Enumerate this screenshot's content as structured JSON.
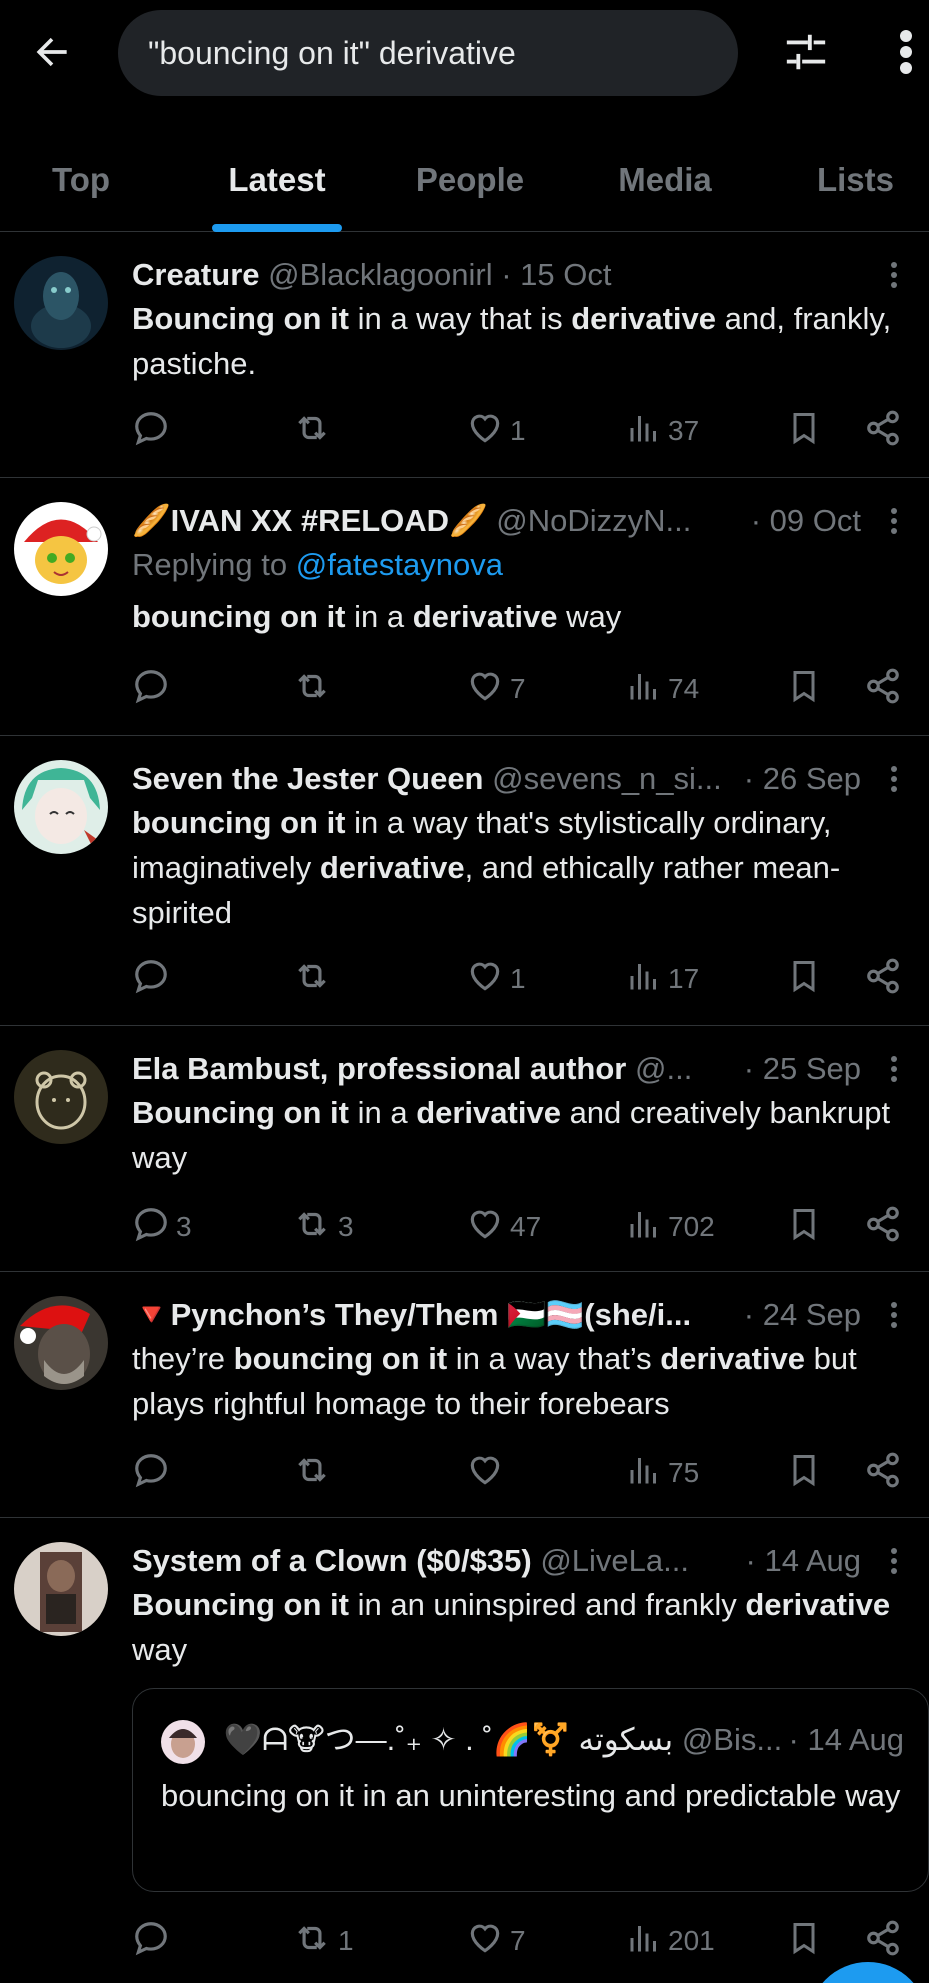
{
  "search": {
    "query": "\"bouncing on it\" derivative"
  },
  "tabs": [
    {
      "label": "Top"
    },
    {
      "label": "Latest"
    },
    {
      "label": "People"
    },
    {
      "label": "Media"
    },
    {
      "label": "Lists"
    }
  ],
  "colors": {
    "accent": "#1d9bf0",
    "muted": "#71767b",
    "text": "#e7e9ea",
    "background": "#000000"
  },
  "posts": [
    {
      "name": "Creature",
      "handle": "@Blacklagoonirl",
      "time": "15 Oct",
      "text_parts": [
        {
          "b": "Bouncing on it"
        },
        {
          "t": " in a way that is "
        },
        {
          "b": "derivative"
        },
        {
          "t": " and, frankly, pastiche."
        }
      ],
      "replies": "",
      "reposts": "",
      "likes": "1",
      "views": "37"
    },
    {
      "name": "🥖IVAN XX #RELOAD🥖",
      "handle": "@NoDizzyN...",
      "time": "09 Oct",
      "reply_to_prefix": "Replying to",
      "reply_to": "@fatestaynova",
      "text_parts": [
        {
          "b": "bouncing on it"
        },
        {
          "t": " in a "
        },
        {
          "b": "derivative"
        },
        {
          "t": " way"
        }
      ],
      "replies": "",
      "reposts": "",
      "likes": "7",
      "views": "74"
    },
    {
      "name": "Seven the Jester Queen",
      "handle": "@sevens_n_si...",
      "time": "26 Sep",
      "text_parts": [
        {
          "b": "bouncing on it"
        },
        {
          "t": " in a way that's stylistically ordinary, imaginatively "
        },
        {
          "b": "derivative"
        },
        {
          "t": ", and ethically rather mean-spirited"
        }
      ],
      "replies": "",
      "reposts": "",
      "likes": "1",
      "views": "17"
    },
    {
      "name": "Ela Bambust, professional author",
      "handle": "@...",
      "time": "25 Sep",
      "text_parts": [
        {
          "b": "Bouncing on it"
        },
        {
          "t": " in a "
        },
        {
          "b": "derivative"
        },
        {
          "t": " and creatively bankrupt way"
        }
      ],
      "replies": "3",
      "reposts": "3",
      "likes": "47",
      "views": "702"
    },
    {
      "name": "🔻Pynchon’s They/Them 🇵🇸🏳️‍⚧️(she/i...",
      "handle": "",
      "time": "24 Sep",
      "text_parts": [
        {
          "t": "they’re "
        },
        {
          "b": "bouncing on it"
        },
        {
          "t": " in a way that’s "
        },
        {
          "b": "derivative"
        },
        {
          "t": " but plays rightful homage to their forebears"
        }
      ],
      "replies": "",
      "reposts": "",
      "likes": "",
      "views": "75"
    },
    {
      "name": "System of a Clown ($0/$35)",
      "handle": "@LiveLa...",
      "time": "14 Aug",
      "text_parts": [
        {
          "b": "Bouncing on it"
        },
        {
          "t": " in an uninspired and frankly "
        },
        {
          "b": "derivative"
        },
        {
          "t": " way"
        }
      ],
      "quote": {
        "name": "🖤ᗩ🐮つ—.˚₊ ✧ . ˚🌈⚧️ بسكوته",
        "handle": "@Bis...",
        "time": "14 Aug",
        "text": "bouncing on it in an uninteresting and predictable way"
      },
      "replies": "",
      "reposts": "1",
      "likes": "7",
      "views": "201"
    }
  ]
}
